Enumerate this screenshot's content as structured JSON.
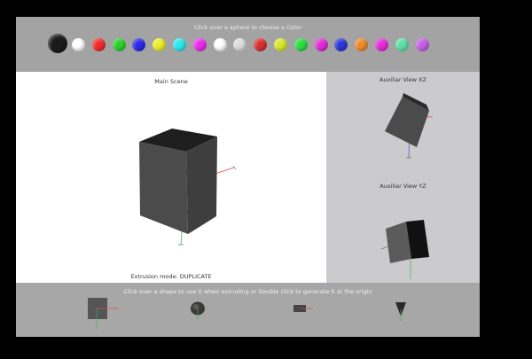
{
  "palette": {
    "instruction": "Click over a sphere to choose a Color",
    "swatches": [
      {
        "color": "#1a1a1a",
        "selected": true
      },
      {
        "color": "#ffffff"
      },
      {
        "color": "#ef2b2b"
      },
      {
        "color": "#2bd12b"
      },
      {
        "color": "#2b2be8"
      },
      {
        "color": "#ecec2b"
      },
      {
        "color": "#2be8ec"
      },
      {
        "color": "#ec2bec"
      },
      {
        "color": "#ffffff"
      },
      {
        "color": "#dcdcdc"
      },
      {
        "color": "#d83030"
      },
      {
        "color": "#d7e82b"
      },
      {
        "color": "#2bdc40"
      },
      {
        "color": "#e02bd6"
      },
      {
        "color": "#2b36d6"
      },
      {
        "color": "#ec8a2b"
      },
      {
        "color": "#e62bd8"
      },
      {
        "color": "#5fe0a8"
      },
      {
        "color": "#c45ee6"
      }
    ]
  },
  "main_scene": {
    "title": "Main Scene",
    "extrusion_mode": "Extrusion mode: DUPLICATE"
  },
  "aux_views": {
    "xz_title": "Auxiliar View XZ",
    "yz_title": "Auxiliar View YZ"
  },
  "shapes_bar": {
    "instruction": "Click over a shape to use it when extruding or Double click to generate it at the origin",
    "shapes": [
      {
        "name": "cube"
      },
      {
        "name": "sphere"
      },
      {
        "name": "cylinder"
      },
      {
        "name": "cone"
      }
    ]
  },
  "colors": {
    "background": "#000000",
    "panel": "#a9a9a9",
    "scene": "#ffffff",
    "aux_panel": "#cbcbcd",
    "axis_x": "#e04a4a",
    "axis_y": "#3cb55c",
    "axis_z": "#3a4fd6"
  }
}
